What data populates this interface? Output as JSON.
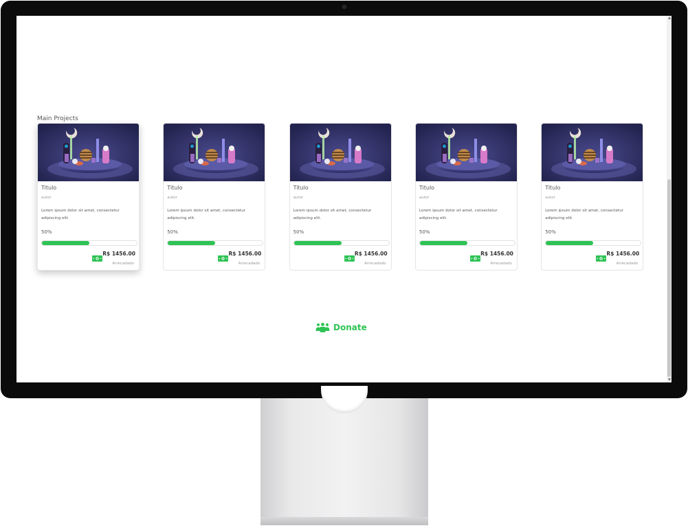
{
  "section": {
    "title": "Main Projects"
  },
  "projects": [
    {
      "title": "Titulo",
      "author": "autor",
      "description": "Lorem ipsum dolor sit amet, consectetur adipiscing elit.",
      "progress_label": "50%",
      "progress": 0.5,
      "amount": "R$ 1456.00",
      "raised_label": "Arrecadado",
      "image_icon": "abstract-3d-scene-image"
    },
    {
      "title": "Titulo",
      "author": "autor",
      "description": "Lorem ipsum dolor sit amet, consectetur adipiscing elit.",
      "progress_label": "50%",
      "progress": 0.5,
      "amount": "R$ 1456.00",
      "raised_label": "Arrecadado",
      "image_icon": "abstract-3d-scene-image"
    },
    {
      "title": "Titulo",
      "author": "autor",
      "description": "Lorem ipsum dolor sit amet, consectetur adipiscing elit.",
      "progress_label": "50%",
      "progress": 0.5,
      "amount": "R$ 1456.00",
      "raised_label": "Arrecadado",
      "image_icon": "abstract-3d-scene-image"
    },
    {
      "title": "Titulo",
      "author": "autor",
      "description": "Lorem ipsum dolor sit amet, consectetur adipiscing elit.",
      "progress_label": "50%",
      "progress": 0.5,
      "amount": "R$ 1456.00",
      "raised_label": "Arrecadado",
      "image_icon": "abstract-3d-scene-image"
    },
    {
      "title": "Titulo",
      "author": "autor",
      "description": "Lorem ipsum dolor sit amet, consectetur adipiscing elit.",
      "progress_label": "50%",
      "progress": 0.5,
      "amount": "R$ 1456.00",
      "raised_label": "Arrecadado",
      "image_icon": "abstract-3d-scene-image"
    }
  ],
  "donate": {
    "label": "Donate",
    "icon": "people-group-icon"
  },
  "colors": {
    "accent": "#2ec354",
    "image_bg": "#2b2b5c",
    "text": "#555555",
    "muted": "#999999"
  }
}
